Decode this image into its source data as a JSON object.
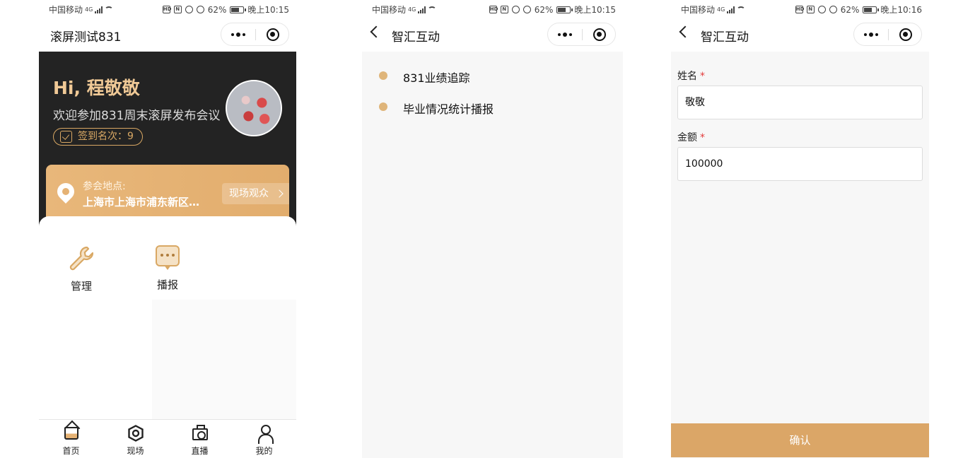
{
  "colors": {
    "accent": "#dba667",
    "hero_bg": "#232323",
    "hi_text": "#f0c996",
    "required": "#e23a3a"
  },
  "icons": {
    "wifi": "wifi-icon",
    "nfc": "nfc-icon",
    "alarm": "alarm-icon",
    "mute": "mute-icon",
    "battery": "battery-icon",
    "location": "location-pin-icon",
    "manage": "wrench-icon",
    "broadcast": "chat-bubble-icon",
    "home": "home-icon",
    "venue": "hexagon-icon",
    "live": "camera-icon",
    "mine": "person-icon"
  },
  "screens": [
    {
      "status": {
        "carrier": "中国移动",
        "network": "4G",
        "battery": "62%",
        "time": "晚上10:15"
      },
      "nav": {
        "title": "滚屏测试831"
      },
      "hero": {
        "greeting": "Hi, 程敬敬",
        "welcome": "欢迎参加831周末滚屏发布会议",
        "checkin": "签到名次：9",
        "location_label": "参会地点:",
        "location_address": "上海市上海市浦东新区…",
        "live_audience": "现场观众"
      },
      "grid": [
        {
          "label": "管理"
        },
        {
          "label": "播报"
        }
      ],
      "tabs": [
        {
          "label": "首页"
        },
        {
          "label": "现场"
        },
        {
          "label": "直播"
        },
        {
          "label": "我的"
        }
      ]
    },
    {
      "status": {
        "carrier": "中国移动",
        "network": "4G",
        "battery": "62%",
        "time": "晚上10:15"
      },
      "nav": {
        "title": "智汇互动"
      },
      "list": [
        {
          "label": "831业绩追踪"
        },
        {
          "label": "毕业情况统计播报"
        }
      ]
    },
    {
      "status": {
        "carrier": "中国移动",
        "network": "4G",
        "battery": "62%",
        "time": "晚上10:16"
      },
      "nav": {
        "title": "智汇互动"
      },
      "form": {
        "name_label": "姓名",
        "name_value": "敬敬",
        "amount_label": "金额",
        "amount_value": "100000",
        "required_mark": "*",
        "confirm": "确认"
      }
    }
  ]
}
